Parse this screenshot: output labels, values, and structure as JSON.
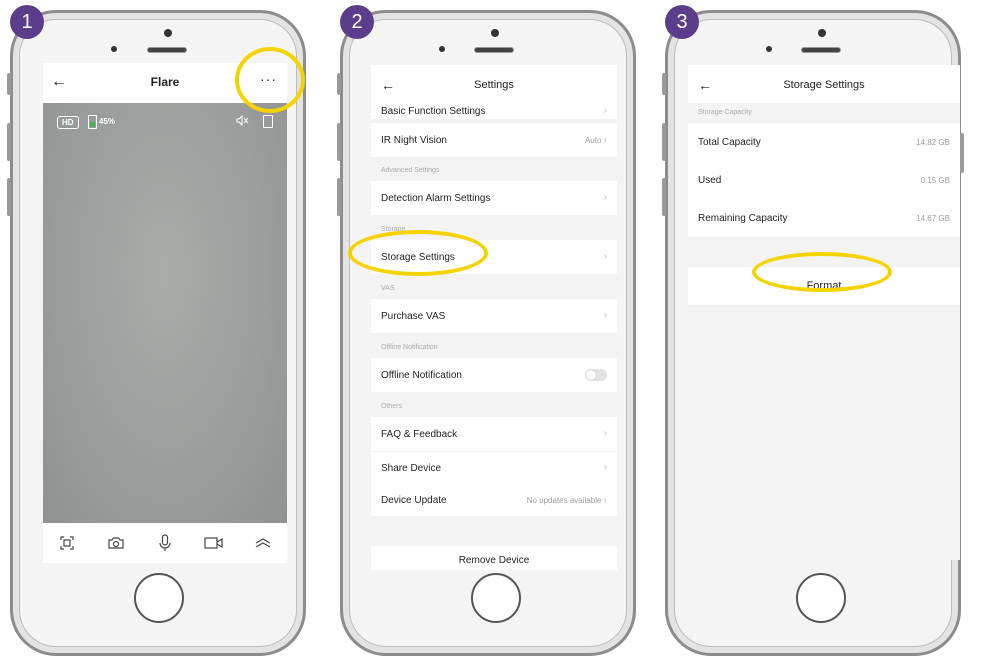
{
  "steps": [
    "1",
    "2",
    "3"
  ],
  "screen1": {
    "title": "Flare",
    "back_icon": "back-arrow-icon",
    "more_icon": "more-dots-icon",
    "more_glyph": "···",
    "hd_label": "HD",
    "battery_percent": "45%",
    "battery_level": 0.45,
    "toolbar": [
      "screenshot-icon",
      "camera-icon",
      "microphone-icon",
      "video-record-icon",
      "expand-icon"
    ]
  },
  "screen2": {
    "title": "Settings",
    "rows": {
      "basic": {
        "label": "Basic Function Settings"
      },
      "ir": {
        "label": "IR Night Vision",
        "value": "Auto"
      },
      "advanced_section": "Advanced Settings",
      "detection": {
        "label": "Detection Alarm Settings"
      },
      "storage_section": "Storage",
      "storage": {
        "label": "Storage Settings"
      },
      "vas_section": "VAS",
      "vas": {
        "label": "Purchase VAS"
      },
      "offline_section": "Offline Notification",
      "offline": {
        "label": "Offline Notification",
        "toggle_on": false
      },
      "others_section": "Others",
      "faq": {
        "label": "FAQ & Feedback"
      },
      "share": {
        "label": "Share Device"
      },
      "update": {
        "label": "Device Update",
        "value": "No updates available"
      }
    },
    "remove": "Remove Device"
  },
  "screen3": {
    "title": "Storage Settings",
    "section": "Storage Capacity",
    "total": {
      "label": "Total Capacity",
      "value": "14.82 GB"
    },
    "used": {
      "label": "Used",
      "value": "0.15 GB"
    },
    "remaining": {
      "label": "Remaining Capacity",
      "value": "14.67 GB"
    },
    "format": "Format"
  },
  "colors": {
    "badge": "#5b3d8c",
    "highlight": "#f4d300",
    "battery": "#3fb34f"
  }
}
